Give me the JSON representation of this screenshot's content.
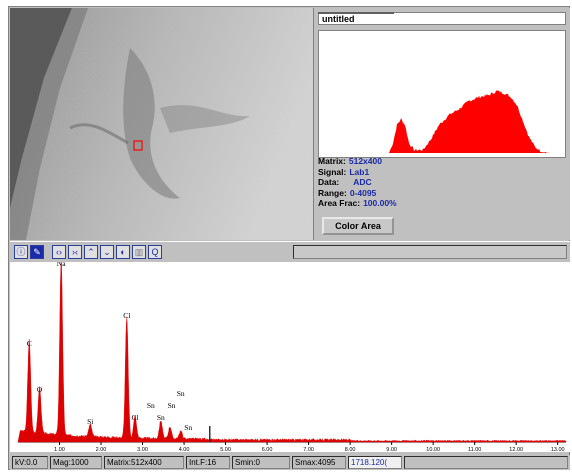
{
  "panel": {
    "title": "untitled",
    "info": [
      {
        "label": "Matrix:",
        "value": "512x400"
      },
      {
        "label": "Signal:",
        "value": "Lab1"
      },
      {
        "label": "Data:",
        "value": "ADC"
      },
      {
        "label": "Range:",
        "value": "0-4095"
      },
      {
        "label": "Area Frac:",
        "value": "100.00%"
      }
    ],
    "color_area_label": "Color Area"
  },
  "toolbar": {
    "icons": [
      "info-icon",
      "color-picker-icon",
      "expand-icon",
      "collapse-icon",
      "scale-up-icon",
      "scale-down-icon",
      "marker-icon",
      "spectrum-icon",
      "zoom-icon"
    ]
  },
  "spectrum": {
    "peak_labels": [
      "C",
      "O",
      "Na",
      "Si",
      "Cl",
      "Cl",
      "Sn",
      "Sn",
      "Sn",
      "Sn",
      "Sn"
    ],
    "tick_labels": [
      "1.00",
      "2.00",
      "3.00",
      "4.00",
      "5.00",
      "6.00",
      "7.00",
      "8.00",
      "9.00",
      "10.00",
      "11.00",
      "12.00",
      "13.00"
    ]
  },
  "status": {
    "kv": "kV:0.0",
    "mag": "Mag:1000",
    "matrix": "Matrix:512x400",
    "intf": "Int.F:16",
    "smin": "Smin:0",
    "smax": "Smax:4095",
    "coords": "1718.120("
  },
  "colors": {
    "histogram": "#ff0000",
    "spectrum": "#dd0000",
    "value_text": "#1a2aa8",
    "chrome": "#c0c0c0"
  }
}
